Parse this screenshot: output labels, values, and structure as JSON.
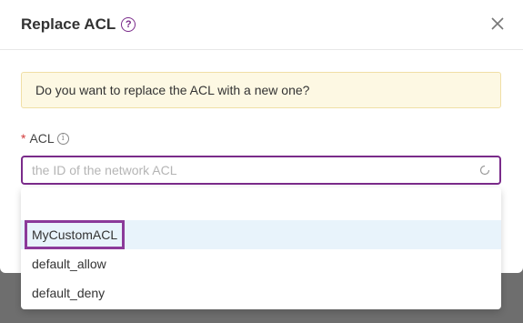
{
  "dialog": {
    "title": "Replace ACL",
    "help_icon": "question-circle-icon",
    "close_icon": "close-icon"
  },
  "warning": {
    "text": "Do you want to replace the ACL with a new one?"
  },
  "acl_field": {
    "required_marker": "*",
    "label": "ACL",
    "info_icon": "info-circle-icon",
    "placeholder": "the ID of the network ACL",
    "loading_icon": "loading-icon"
  },
  "dropdown": {
    "options": [
      {
        "label": "MyCustomACL",
        "active": true,
        "highlighted": true
      },
      {
        "label": "default_allow"
      },
      {
        "label": "default_deny"
      }
    ]
  },
  "colors": {
    "accent": "#7a2b8a",
    "warning_bg": "#fdf8e3",
    "active_option_bg": "#e8f3fb",
    "required": "#d23b3b"
  }
}
